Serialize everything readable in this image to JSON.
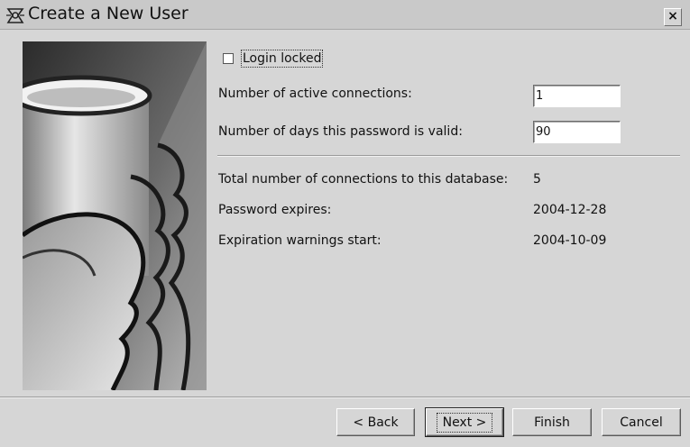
{
  "window": {
    "title": "Create a New User",
    "close_glyph": "×",
    "icon": "user-wizard-icon"
  },
  "login_locked": {
    "label": "Login locked",
    "checked": false
  },
  "fields": {
    "active_connections": {
      "label": "Number of active connections:",
      "value": "1"
    },
    "password_days": {
      "label": "Number of days this password is valid:",
      "value": "90"
    }
  },
  "info": {
    "total_connections": {
      "label": "Total number of connections to this database:",
      "value": "5"
    },
    "password_expires": {
      "label": "Password expires:",
      "value": "2004-12-28"
    },
    "warnings_start": {
      "label": "Expiration warnings start:",
      "value": "2004-10-09"
    }
  },
  "buttons": {
    "back": "< Back",
    "next": "Next >",
    "finish": "Finish",
    "cancel": "Cancel"
  }
}
